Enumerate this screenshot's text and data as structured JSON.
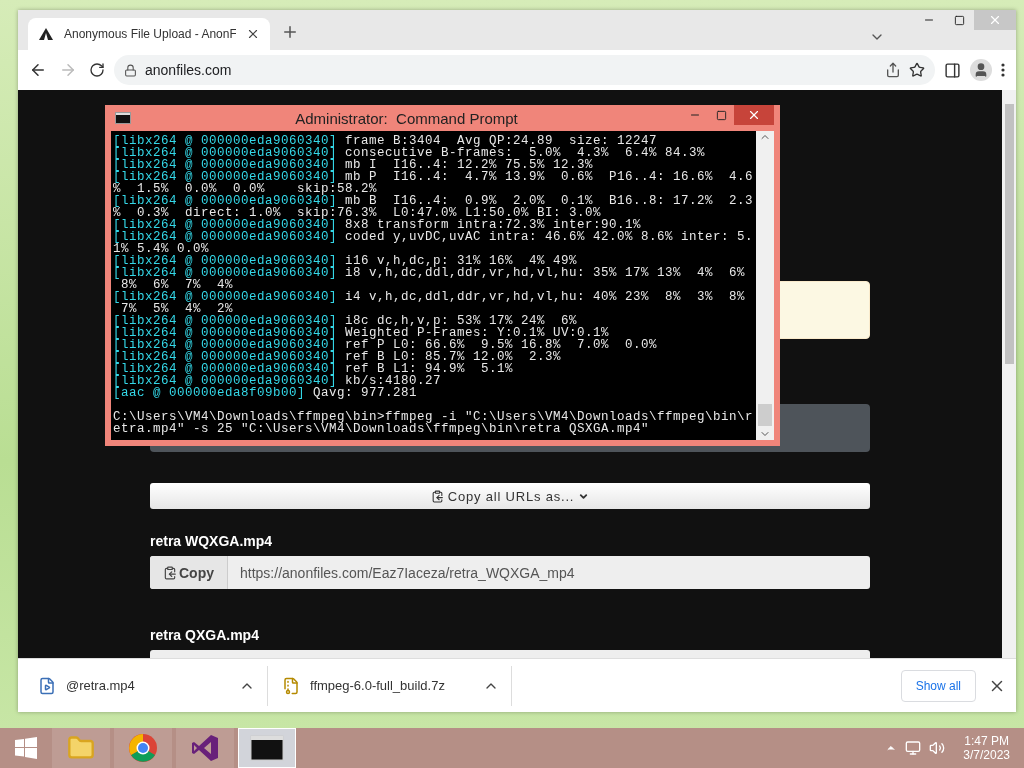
{
  "browser": {
    "tab": {
      "title": "Anonymous File Upload - AnonF"
    },
    "address": "anonfiles.com"
  },
  "page": {
    "copy_all": "Copy all URLs as...",
    "files": [
      {
        "name": "retra WQXGA.mp4",
        "copy": "Copy",
        "url": "https://anonfiles.com/Eaz7Iaceza/retra_WQXGA_mp4"
      },
      {
        "name": "retra QXGA.mp4"
      }
    ]
  },
  "downloads": {
    "items": [
      {
        "name": "@retra.mp4",
        "kind": "video"
      },
      {
        "name": "ffmpeg-6.0-full_build.7z",
        "kind": "archive"
      }
    ],
    "show_all": "Show all"
  },
  "console": {
    "title": "Administrator:  Command Prompt",
    "lines": [
      {
        "tag": "[libx264 @ 000000eda9060340]",
        "text": " frame B:3404  Avg QP:24.89  size: 12247"
      },
      {
        "tag": "[libx264 @ 000000eda9060340]",
        "text": " consecutive B-frames:  5.0%  4.3%  6.4% 84.3%"
      },
      {
        "tag": "[libx264 @ 000000eda9060340]",
        "text": " mb I  I16..4: 12.2% 75.5% 12.3%"
      },
      {
        "tag": "[libx264 @ 000000eda9060340]",
        "text": " mb P  I16..4:  4.7% 13.9%  0.6%  P16..4: 16.6%  4.6"
      },
      {
        "text": "%  1.5%  0.0%  0.0%    skip:58.2%"
      },
      {
        "tag": "[libx264 @ 000000eda9060340]",
        "text": " mb B  I16..4:  0.9%  2.0%  0.1%  B16..8: 17.2%  2.3"
      },
      {
        "text": "%  0.3%  direct: 1.0%  skip:76.3%  L0:47.0% L1:50.0% BI: 3.0%"
      },
      {
        "tag": "[libx264 @ 000000eda9060340]",
        "text": " 8x8 transform intra:72.3% inter:90.1%"
      },
      {
        "tag": "[libx264 @ 000000eda9060340]",
        "text": " coded y,uvDC,uvAC intra: 46.6% 42.0% 8.6% inter: 5."
      },
      {
        "text": "1% 5.4% 0.0%"
      },
      {
        "tag": "[libx264 @ 000000eda9060340]",
        "text": " i16 v,h,dc,p: 31% 16%  4% 49%"
      },
      {
        "tag": "[libx264 @ 000000eda9060340]",
        "text": " i8 v,h,dc,ddl,ddr,vr,hd,vl,hu: 35% 17% 13%  4%  6%"
      },
      {
        "text": " 8%  6%  7%  4%"
      },
      {
        "tag": "[libx264 @ 000000eda9060340]",
        "text": " i4 v,h,dc,ddl,ddr,vr,hd,vl,hu: 40% 23%  8%  3%  8%"
      },
      {
        "text": " 7%  5%  4%  2%"
      },
      {
        "tag": "[libx264 @ 000000eda9060340]",
        "text": " i8c dc,h,v,p: 53% 17% 24%  6%"
      },
      {
        "tag": "[libx264 @ 000000eda9060340]",
        "text": " Weighted P-Frames: Y:0.1% UV:0.1%"
      },
      {
        "tag": "[libx264 @ 000000eda9060340]",
        "text": " ref P L0: 66.6%  9.5% 16.8%  7.0%  0.0%"
      },
      {
        "tag": "[libx264 @ 000000eda9060340]",
        "text": " ref B L0: 85.7% 12.0%  2.3%"
      },
      {
        "tag": "[libx264 @ 000000eda9060340]",
        "text": " ref B L1: 94.9%  5.1%"
      },
      {
        "tag": "[libx264 @ 000000eda9060340]",
        "text": " kb/s:4180.27"
      },
      {
        "tag": "[aac @ 000000eda8f09b00]",
        "text": " Qavg: 977.281"
      },
      {
        "gap_before": true,
        "text": "C:\\Users\\VM4\\Downloads\\ffmpeg\\bin>ffmpeg -i \"C:\\Users\\VM4\\Downloads\\ffmpeg\\bin\\r"
      },
      {
        "text": "etra.mp4\" -s 25 \"C:\\Users\\VM4\\Downloads\\ffmpeg\\bin\\retra QSXGA.mp4\""
      }
    ]
  },
  "taskbar": {
    "apps": [
      {
        "kind": "explorer",
        "selected": false
      },
      {
        "kind": "chrome",
        "selected": false
      },
      {
        "kind": "studio",
        "selected": false
      },
      {
        "kind": "cmd",
        "selected": true
      }
    ],
    "time": "1:47 PM",
    "date": "3/7/2023"
  }
}
